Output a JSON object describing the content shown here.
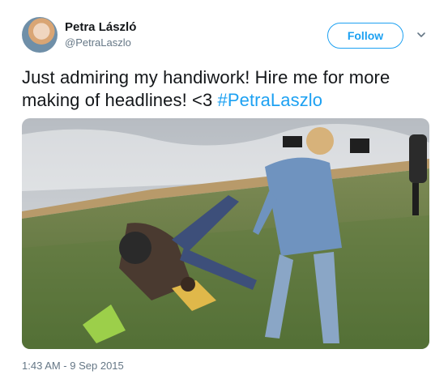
{
  "author": {
    "display_name": "Petra László",
    "handle": "@PetraLaszlo"
  },
  "follow_label": "Follow",
  "tweet": {
    "text": "Just admiring my handiwork! Hire me for more making of headlines! <3 ",
    "hashtag": "#PetraLaszlo"
  },
  "timestamp": "1:43 AM - 9 Sep 2015",
  "colors": {
    "accent": "#1da1f2",
    "text": "#14171a",
    "muted": "#657786"
  },
  "icons": {
    "more": "chevron-down-icon"
  }
}
